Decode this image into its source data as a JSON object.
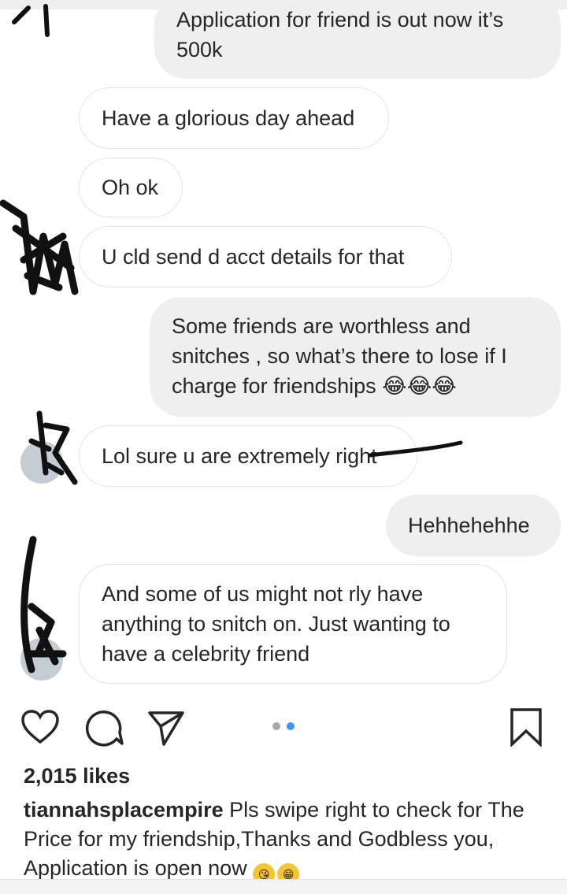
{
  "messages": [
    {
      "id": "m1",
      "direction": "outgoing",
      "lines": [
        "Application for friend is out now it’s",
        "500k"
      ]
    },
    {
      "id": "m2",
      "direction": "incoming",
      "lines": [
        "Have a glorious day ahead"
      ]
    },
    {
      "id": "m3",
      "direction": "incoming",
      "lines": [
        "Oh ok"
      ]
    },
    {
      "id": "m4",
      "direction": "incoming",
      "lines": [
        "U cld send d acct details for that"
      ]
    },
    {
      "id": "m5",
      "direction": "outgoing",
      "lines": [
        "Some friends are worthless and",
        "snitches , so what’s there to lose if I",
        "charge for friendships 😂😂😂"
      ]
    },
    {
      "id": "m6",
      "direction": "incoming",
      "lines": [
        "Lol sure u are extremely right"
      ]
    },
    {
      "id": "m7",
      "direction": "outgoing",
      "lines": [
        "Hehhehehhe"
      ]
    },
    {
      "id": "m8",
      "direction": "incoming",
      "lines": [
        "And some of us might not rly have",
        "anything to snitch on. Just wanting to",
        "have a celebrity friend"
      ]
    }
  ],
  "post": {
    "likes": "2,015 likes",
    "username": "tiannahsplacempire",
    "caption": "Pls swipe right to check for The Price for my friendship,Thanks and Godbless you, Application is open now",
    "caption_emojis": [
      "😘",
      "😁"
    ],
    "carousel": {
      "count": 2,
      "active": 2
    },
    "icons": {
      "like": "heart-icon",
      "comment": "comment-icon",
      "share": "share-icon",
      "save": "bookmark-icon"
    }
  },
  "colors": {
    "accent": "#3897f0",
    "inactive_dot": "#a8a8a8",
    "outgoing_bubble": "#efefef",
    "incoming_border": "#e3e3e3"
  }
}
